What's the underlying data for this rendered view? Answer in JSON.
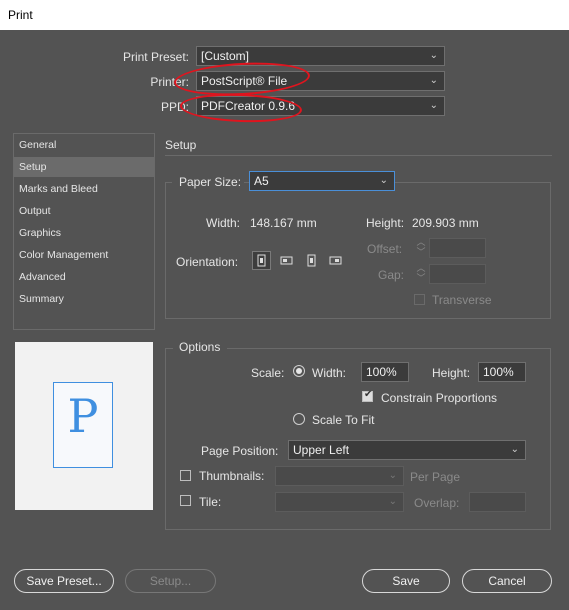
{
  "window": {
    "title": "Print"
  },
  "header": {
    "preset_label": "Print Preset:",
    "preset_value": "[Custom]",
    "printer_label": "Printer:",
    "printer_value": "PostScript® File",
    "ppd_label": "PPD:",
    "ppd_value": "PDFCreator 0.9.6"
  },
  "sidebar": {
    "items": [
      {
        "label": "General"
      },
      {
        "label": "Setup"
      },
      {
        "label": "Marks and Bleed"
      },
      {
        "label": "Output"
      },
      {
        "label": "Graphics"
      },
      {
        "label": "Color Management"
      },
      {
        "label": "Advanced"
      },
      {
        "label": "Summary"
      }
    ],
    "selected": "Setup"
  },
  "preview": {
    "glyph": "P"
  },
  "setup": {
    "section_title": "Setup",
    "paper_size_label": "Paper Size:",
    "paper_size_value": "A5",
    "width_label": "Width:",
    "width_value": "148.167 mm",
    "height_label": "Height:",
    "height_value": "209.903 mm",
    "orientation_label": "Orientation:",
    "offset_label": "Offset:",
    "gap_label": "Gap:",
    "transverse_label": "Transverse"
  },
  "options": {
    "section_title": "Options",
    "scale_label": "Scale:",
    "width_label": "Width:",
    "width_value": "100%",
    "height_label": "Height:",
    "height_value": "100%",
    "constrain_label": "Constrain Proportions",
    "scale_to_fit_label": "Scale To Fit",
    "page_position_label": "Page Position:",
    "page_position_value": "Upper Left",
    "thumbnails_label": "Thumbnails:",
    "per_page_label": "Per Page",
    "tile_label": "Tile:",
    "overlap_label": "Overlap:"
  },
  "footer": {
    "save_preset": "Save Preset...",
    "setup": "Setup...",
    "save": "Save",
    "cancel": "Cancel"
  },
  "colors": {
    "annotation": "#e0141e",
    "selection": "#6b6b6b",
    "preview_glyph": "#3f8fe0"
  }
}
